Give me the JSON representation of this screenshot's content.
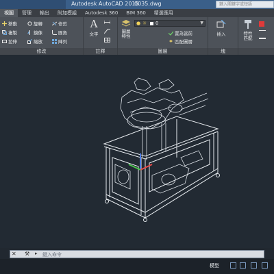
{
  "window": {
    "app_title": "Autodesk AutoCAD 2015",
    "doc_title": "0035.dwg",
    "search_placeholder": "鍵入關鍵字或短語"
  },
  "menu_tabs": [
    "視圖",
    "管理",
    "輸出",
    "附加模組",
    "Autodesk 360",
    "BIM 360",
    "精選應用"
  ],
  "active_tab_index": 0,
  "ribbon": {
    "modify": {
      "title": "修改",
      "buttons": [
        "移動",
        "旋轉",
        "修剪",
        "複製",
        "鏡像",
        "圓角",
        "拉伸",
        "縮放",
        "陣列"
      ]
    },
    "annotation": {
      "title": "註釋",
      "text_label": "文字"
    },
    "layers": {
      "title": "圖層",
      "properties_label": "圖層特性",
      "layer_value": "0",
      "buttons": [
        "置為當前",
        "匹配圖層"
      ]
    },
    "block": {
      "title": "塊",
      "insert_label": "插入"
    },
    "properties": {
      "label": "特性匹配"
    }
  },
  "command_line": {
    "placeholder": "鍵入命令"
  },
  "status_bar": {
    "model_label": "模型"
  },
  "colors": {
    "titlebar": "#3a5f89",
    "ribbon": "#4d5259",
    "canvas": "#222a33",
    "accent": "#6fa8dc"
  }
}
